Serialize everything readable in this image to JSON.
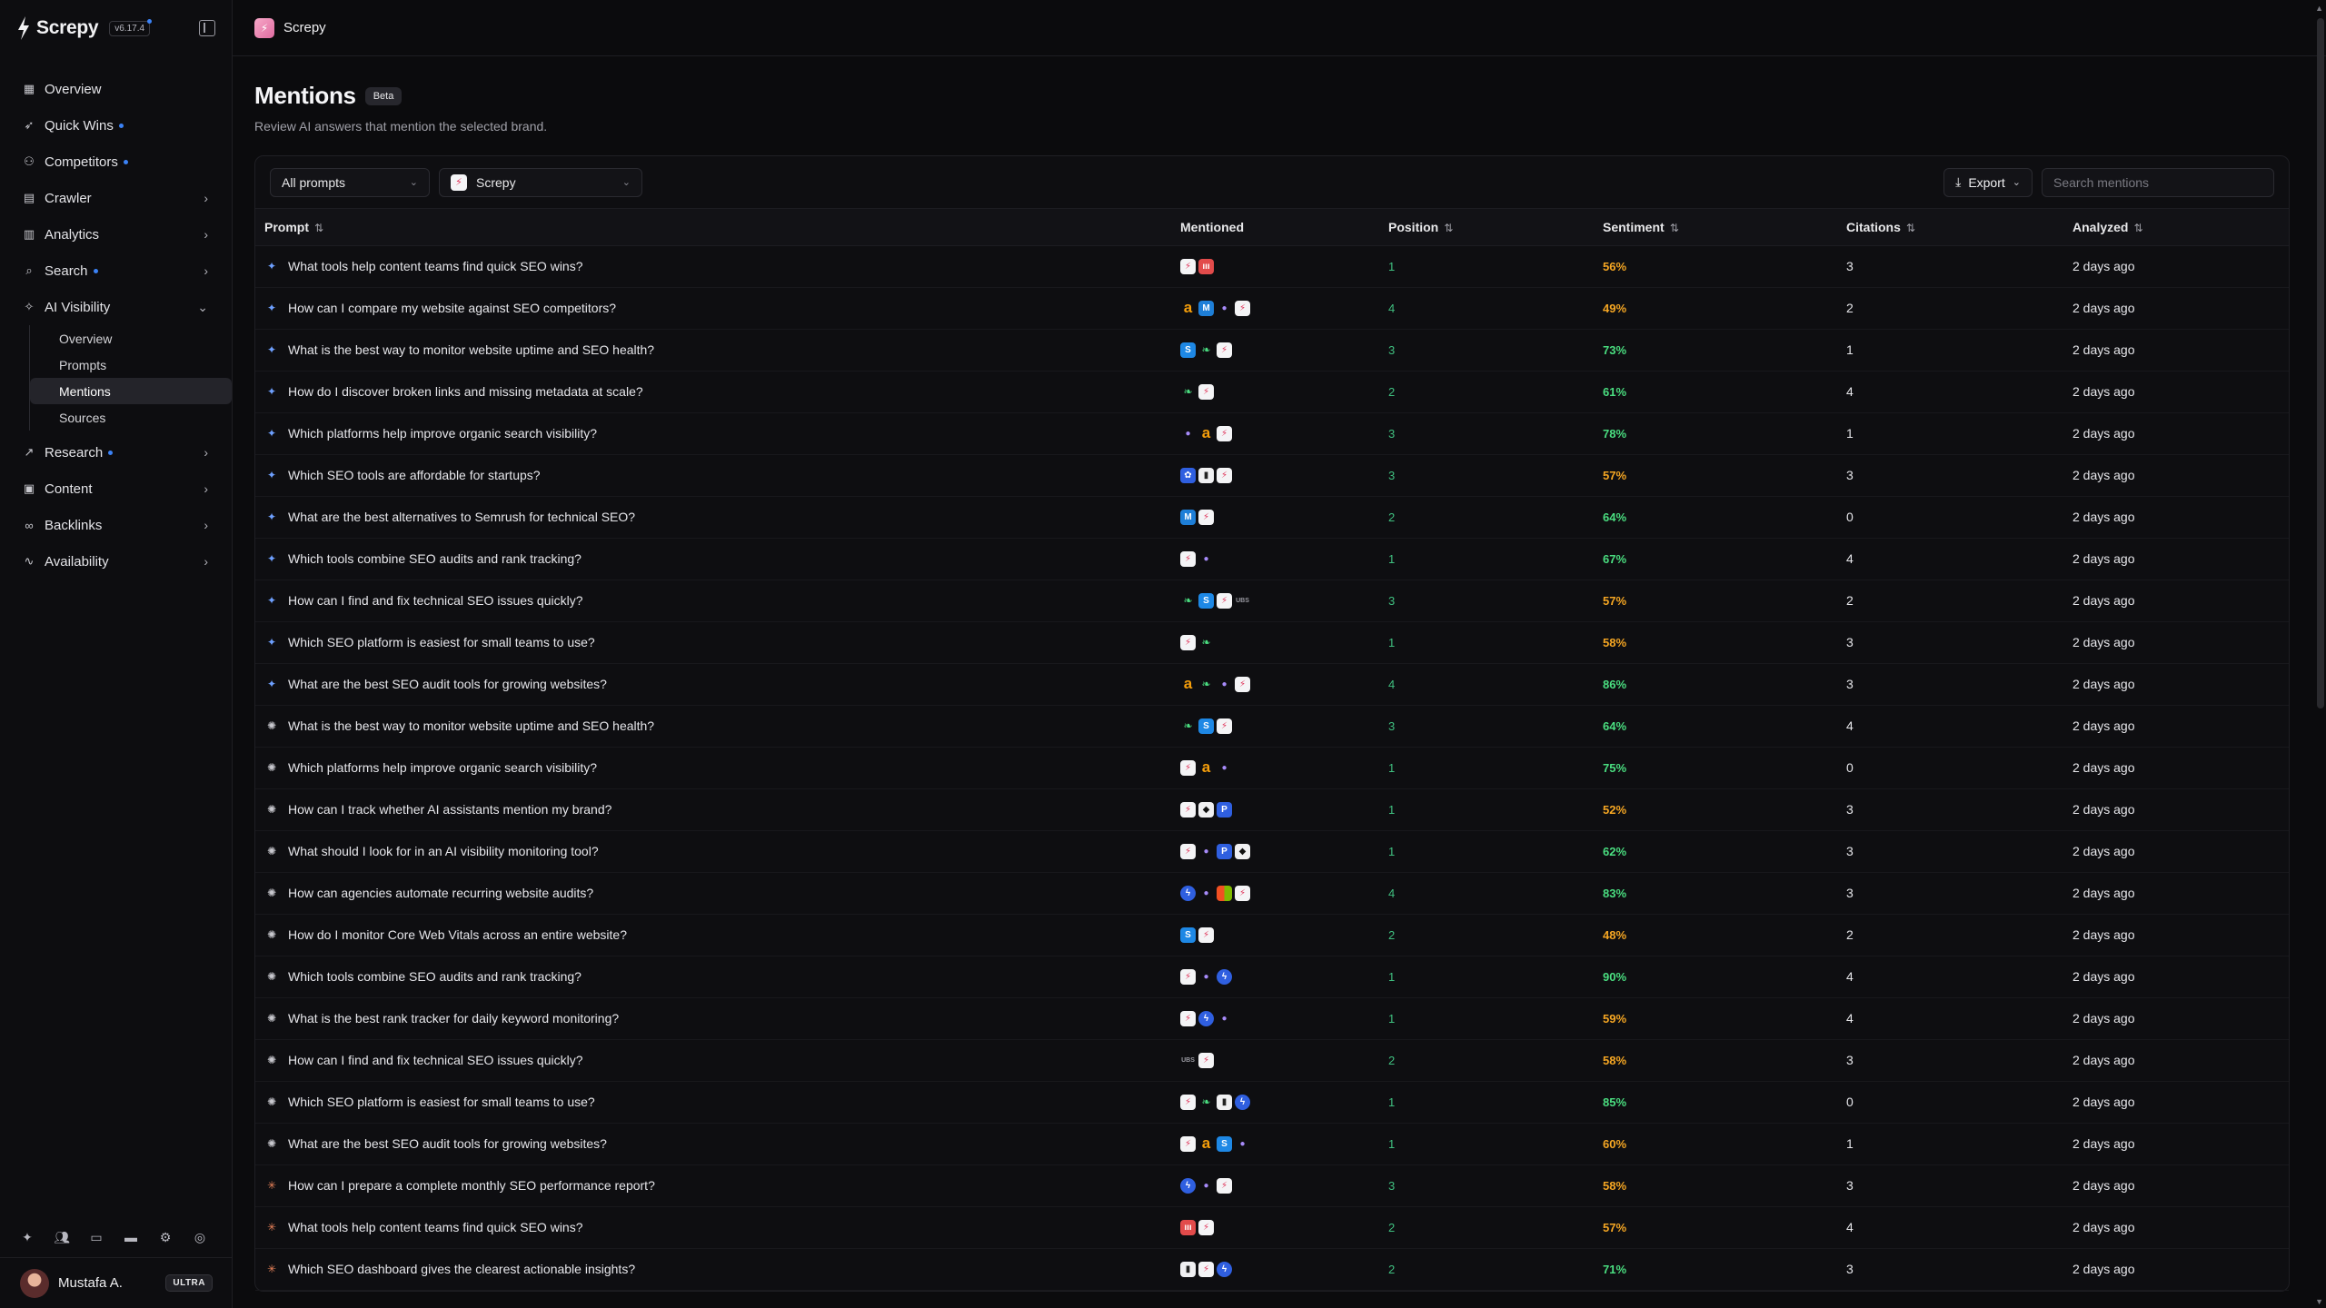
{
  "brand": {
    "name": "Screpy",
    "version": "v6.17.4"
  },
  "sidebar": {
    "items": [
      {
        "key": "overview",
        "label": "Overview",
        "icon": "grid-icon",
        "dot": false,
        "chevron": ""
      },
      {
        "key": "quick-wins",
        "label": "Quick Wins",
        "icon": "rocket-icon",
        "dot": true,
        "chevron": ""
      },
      {
        "key": "competitors",
        "label": "Competitors",
        "icon": "users-icon",
        "dot": true,
        "chevron": ""
      },
      {
        "key": "crawler",
        "label": "Crawler",
        "icon": "file-icon",
        "dot": false,
        "chevron": "›"
      },
      {
        "key": "analytics",
        "label": "Analytics",
        "icon": "bar-chart-icon",
        "dot": false,
        "chevron": "›"
      },
      {
        "key": "search",
        "label": "Search",
        "icon": "search-icon",
        "dot": true,
        "chevron": "›"
      },
      {
        "key": "ai-visibility",
        "label": "AI Visibility",
        "icon": "sparkle-icon",
        "dot": false,
        "chevron": "⌄"
      }
    ],
    "ai_sub": [
      {
        "label": "Overview",
        "active": false
      },
      {
        "label": "Prompts",
        "active": false
      },
      {
        "label": "Mentions",
        "active": true
      },
      {
        "label": "Sources",
        "active": false
      }
    ],
    "items2": [
      {
        "key": "research",
        "label": "Research",
        "icon": "trend-icon",
        "dot": true,
        "chevron": "›"
      },
      {
        "key": "content",
        "label": "Content",
        "icon": "document-icon",
        "dot": false,
        "chevron": "›"
      },
      {
        "key": "backlinks",
        "label": "Backlinks",
        "icon": "link-icon",
        "dot": false,
        "chevron": "›"
      },
      {
        "key": "availability",
        "label": "Availability",
        "icon": "pulse-icon",
        "dot": false,
        "chevron": "›"
      }
    ],
    "user": {
      "name": "Mustafa A.",
      "plan": "ULTRA"
    }
  },
  "topbar": {
    "workspace": "Screpy"
  },
  "page": {
    "title": "Mentions",
    "badge": "Beta",
    "subtitle": "Review AI answers that mention the selected brand."
  },
  "toolbar": {
    "prompts_filter": "All prompts",
    "brand_filter": "Screpy",
    "export_label": "Export",
    "search_placeholder": "Search mentions"
  },
  "table": {
    "headers": {
      "prompt": "Prompt",
      "mentioned": "Mentioned",
      "position": "Position",
      "sentiment": "Sentiment",
      "citations": "Citations",
      "analyzed": "Analyzed"
    },
    "rows": [
      {
        "model": "gemini",
        "prompt": "What tools help content teams find quick SEO wins?",
        "chips": [
          "screpy",
          "semr"
        ],
        "position": "1",
        "sentiment": "56%",
        "tone": "amber",
        "citations": "3",
        "analyzed": "2 days ago"
      },
      {
        "model": "gemini",
        "prompt": "How can I compare my website against SEO competitors?",
        "chips": [
          "amazon",
          "moz",
          "orb",
          "screpy"
        ],
        "position": "4",
        "sentiment": "49%",
        "tone": "amber",
        "citations": "2",
        "analyzed": "2 days ago"
      },
      {
        "model": "gemini",
        "prompt": "What is the best way to monitor website uptime and SEO health?",
        "chips": [
          "s",
          "leaf",
          "screpy"
        ],
        "position": "3",
        "sentiment": "73%",
        "tone": "green",
        "citations": "1",
        "analyzed": "2 days ago"
      },
      {
        "model": "gemini",
        "prompt": "How do I discover broken links and missing metadata at scale?",
        "chips": [
          "leaf",
          "screpy"
        ],
        "position": "2",
        "sentiment": "61%",
        "tone": "green",
        "citations": "4",
        "analyzed": "2 days ago"
      },
      {
        "model": "gemini",
        "prompt": "Which platforms help improve organic search visibility?",
        "chips": [
          "orb",
          "amazon",
          "screpy"
        ],
        "position": "3",
        "sentiment": "78%",
        "tone": "green",
        "citations": "1",
        "analyzed": "2 days ago"
      },
      {
        "model": "gemini",
        "prompt": "Which SEO tools are affordable for startups?",
        "chips": [
          "gear",
          "book",
          "screpy"
        ],
        "position": "3",
        "sentiment": "57%",
        "tone": "amber",
        "citations": "3",
        "analyzed": "2 days ago"
      },
      {
        "model": "gemini",
        "prompt": "What are the best alternatives to Semrush for technical SEO?",
        "chips": [
          "moz",
          "screpy"
        ],
        "position": "2",
        "sentiment": "64%",
        "tone": "green",
        "citations": "0",
        "analyzed": "2 days ago"
      },
      {
        "model": "gemini",
        "prompt": "Which tools combine SEO audits and rank tracking?",
        "chips": [
          "screpy",
          "orb"
        ],
        "position": "1",
        "sentiment": "67%",
        "tone": "green",
        "citations": "4",
        "analyzed": "2 days ago"
      },
      {
        "model": "gemini",
        "prompt": "How can I find and fix technical SEO issues quickly?",
        "chips": [
          "leaf",
          "s",
          "screpy",
          "ubs"
        ],
        "position": "3",
        "sentiment": "57%",
        "tone": "amber",
        "citations": "2",
        "analyzed": "2 days ago"
      },
      {
        "model": "gemini",
        "prompt": "Which SEO platform is easiest for small teams to use?",
        "chips": [
          "screpy",
          "leaf"
        ],
        "position": "1",
        "sentiment": "58%",
        "tone": "amber",
        "citations": "3",
        "analyzed": "2 days ago"
      },
      {
        "model": "gemini",
        "prompt": "What are the best SEO audit tools for growing websites?",
        "chips": [
          "amazon",
          "leaf",
          "orb",
          "screpy"
        ],
        "position": "4",
        "sentiment": "86%",
        "tone": "green",
        "citations": "3",
        "analyzed": "2 days ago"
      },
      {
        "model": "gpt",
        "prompt": "What is the best way to monitor website uptime and SEO health?",
        "chips": [
          "leaf",
          "s",
          "screpy"
        ],
        "position": "3",
        "sentiment": "64%",
        "tone": "green",
        "citations": "4",
        "analyzed": "2 days ago"
      },
      {
        "model": "gpt",
        "prompt": "Which platforms help improve organic search visibility?",
        "chips": [
          "screpy",
          "amazon",
          "orb"
        ],
        "position": "1",
        "sentiment": "75%",
        "tone": "green",
        "citations": "0",
        "analyzed": "2 days ago"
      },
      {
        "model": "gpt",
        "prompt": "How can I track whether AI assistants mention my brand?",
        "chips": [
          "screpy",
          "shield",
          "p"
        ],
        "position": "1",
        "sentiment": "52%",
        "tone": "amber",
        "citations": "3",
        "analyzed": "2 days ago"
      },
      {
        "model": "gpt",
        "prompt": "What should I look for in an AI visibility monitoring tool?",
        "chips": [
          "screpy",
          "orb",
          "p",
          "shield"
        ],
        "position": "1",
        "sentiment": "62%",
        "tone": "green",
        "citations": "3",
        "analyzed": "2 days ago"
      },
      {
        "model": "gpt",
        "prompt": "How can agencies automate recurring website audits?",
        "chips": [
          "bolt",
          "orb",
          "grid",
          "screpy"
        ],
        "position": "4",
        "sentiment": "83%",
        "tone": "green",
        "citations": "3",
        "analyzed": "2 days ago"
      },
      {
        "model": "gpt",
        "prompt": "How do I monitor Core Web Vitals across an entire website?",
        "chips": [
          "s",
          "screpy"
        ],
        "position": "2",
        "sentiment": "48%",
        "tone": "amber",
        "citations": "2",
        "analyzed": "2 days ago"
      },
      {
        "model": "gpt",
        "prompt": "Which tools combine SEO audits and rank tracking?",
        "chips": [
          "screpy",
          "orb",
          "bolt"
        ],
        "position": "1",
        "sentiment": "90%",
        "tone": "green",
        "citations": "4",
        "analyzed": "2 days ago"
      },
      {
        "model": "gpt",
        "prompt": "What is the best rank tracker for daily keyword monitoring?",
        "chips": [
          "screpy",
          "bolt",
          "orb"
        ],
        "position": "1",
        "sentiment": "59%",
        "tone": "amber",
        "citations": "4",
        "analyzed": "2 days ago"
      },
      {
        "model": "gpt",
        "prompt": "How can I find and fix technical SEO issues quickly?",
        "chips": [
          "ubs",
          "screpy"
        ],
        "position": "2",
        "sentiment": "58%",
        "tone": "amber",
        "citations": "3",
        "analyzed": "2 days ago"
      },
      {
        "model": "gpt",
        "prompt": "Which SEO platform is easiest for small teams to use?",
        "chips": [
          "screpy",
          "leaf",
          "book",
          "bolt"
        ],
        "position": "1",
        "sentiment": "85%",
        "tone": "green",
        "citations": "0",
        "analyzed": "2 days ago"
      },
      {
        "model": "gpt",
        "prompt": "What are the best SEO audit tools for growing websites?",
        "chips": [
          "screpy",
          "amazon",
          "s",
          "orb"
        ],
        "position": "1",
        "sentiment": "60%",
        "tone": "amber",
        "citations": "1",
        "analyzed": "2 days ago"
      },
      {
        "model": "claude",
        "prompt": "How can I prepare a complete monthly SEO performance report?",
        "chips": [
          "bolt",
          "orb",
          "screpy"
        ],
        "position": "3",
        "sentiment": "58%",
        "tone": "amber",
        "citations": "3",
        "analyzed": "2 days ago"
      },
      {
        "model": "claude",
        "prompt": "What tools help content teams find quick SEO wins?",
        "chips": [
          "semr",
          "screpy"
        ],
        "position": "2",
        "sentiment": "57%",
        "tone": "amber",
        "citations": "4",
        "analyzed": "2 days ago"
      },
      {
        "model": "claude",
        "prompt": "Which SEO dashboard gives the clearest actionable insights?",
        "chips": [
          "book",
          "screpy",
          "bolt"
        ],
        "position": "2",
        "sentiment": "71%",
        "tone": "green",
        "citations": "3",
        "analyzed": "2 days ago"
      }
    ]
  },
  "colors": {
    "accent": "#3b82f6",
    "positive": "#4ade80",
    "neutral": "#f5a623",
    "position": "#3fbf7f"
  }
}
